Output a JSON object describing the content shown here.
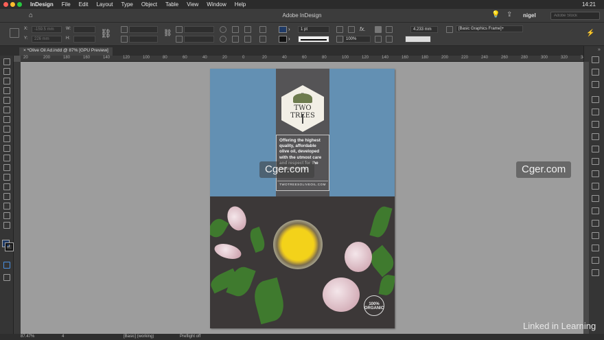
{
  "menubar": {
    "app_name": "InDesign",
    "items": [
      "File",
      "Edit",
      "Layout",
      "Type",
      "Object",
      "Table",
      "View",
      "Window",
      "Help"
    ],
    "clock": "14:21"
  },
  "appbar": {
    "title": "Adobe InDesign",
    "user": "nigel",
    "search_placeholder": "Adobe Stock"
  },
  "control": {
    "x_label": "X:",
    "x_value": "-159.5 mm",
    "y_label": "Y:",
    "y_value": "226 mm",
    "w_label": "W:",
    "h_label": "H:",
    "stroke_weight": "1 pt",
    "opacity": "100%",
    "offset_value": "4.233 mm",
    "object_style": "[Basic Graphics Frame]+"
  },
  "tab": {
    "label": "*Olive Oil Ad.indd @ 87% [GPU Preview]"
  },
  "ruler": {
    "labels": [
      "20",
      "200",
      "180",
      "160",
      "140",
      "120",
      "100",
      "80",
      "60",
      "40",
      "20",
      "0",
      "20",
      "40",
      "60",
      "80",
      "100",
      "120",
      "140",
      "160",
      "180",
      "200",
      "220",
      "240",
      "260",
      "280",
      "300",
      "320",
      "340"
    ]
  },
  "artwork": {
    "logo_number": "2",
    "brand": "TWO TREES",
    "blurb": "Offering the highest quality, affordable olive oil, developed with the utmost care and respect for the natural world.",
    "url": "TWOTREESOLIVEOIL.COM",
    "stamp": "100% ORGANIC"
  },
  "watermarks": [
    "Cger.com",
    "Cger.com"
  ],
  "linkedin": "Linked in Learning",
  "statusbar": {
    "zoom": "87.47%",
    "page": "4",
    "profile": "[Basic] (working)",
    "preflight": "Preflight off"
  },
  "colors": {
    "sky": "#6390b3",
    "stripe": "#555456",
    "table": "#3c3838",
    "oil": "#f3d21a",
    "pasteboard": "#9d9d9d"
  }
}
